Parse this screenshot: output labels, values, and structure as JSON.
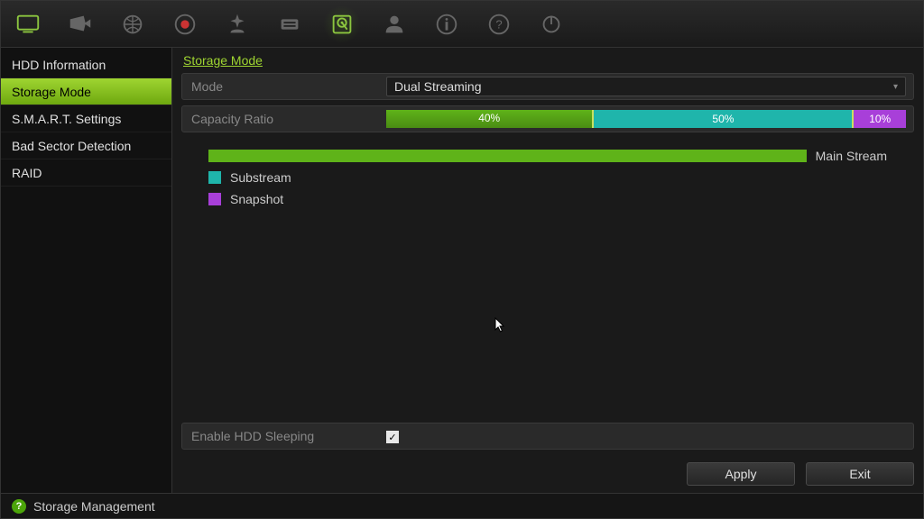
{
  "toolbar_icons": [
    {
      "name": "monitor-icon",
      "active": false
    },
    {
      "name": "camera-icon",
      "active": false
    },
    {
      "name": "network-icon",
      "active": false
    },
    {
      "name": "record-icon",
      "active": false
    },
    {
      "name": "alarm-icon",
      "active": false
    },
    {
      "name": "rs232-icon",
      "active": false
    },
    {
      "name": "hdd-icon",
      "active": true
    },
    {
      "name": "account-icon",
      "active": false
    },
    {
      "name": "info-icon",
      "active": false
    },
    {
      "name": "help-icon",
      "active": false
    },
    {
      "name": "shutdown-icon",
      "active": false
    }
  ],
  "sidebar": {
    "items": [
      {
        "label": "HDD Information",
        "active": false
      },
      {
        "label": "Storage Mode",
        "active": true
      },
      {
        "label": "S.M.A.R.T. Settings",
        "active": false
      },
      {
        "label": "Bad Sector Detection",
        "active": false
      },
      {
        "label": "RAID",
        "active": false
      }
    ]
  },
  "page": {
    "title": "Storage Mode",
    "mode_label": "Mode",
    "mode_value": "Dual Streaming",
    "capacity_label": "Capacity Ratio",
    "sleep_label": "Enable HDD Sleeping",
    "sleep_checked": "✓",
    "apply": "Apply",
    "exit": "Exit"
  },
  "legend": [
    {
      "label": "Main Stream",
      "color": "#5fb319"
    },
    {
      "label": "Substream",
      "color": "#1fb5ab"
    },
    {
      "label": "Snapshot",
      "color": "#a83fd9"
    }
  ],
  "status": {
    "help": "?",
    "label": "Storage Management"
  },
  "chart_data": {
    "type": "bar",
    "categories": [
      "Main Stream",
      "Substream",
      "Snapshot"
    ],
    "values": [
      40,
      50,
      10
    ],
    "title": "Capacity Ratio",
    "xlabel": "",
    "ylabel": "",
    "ylim": [
      0,
      100
    ]
  }
}
